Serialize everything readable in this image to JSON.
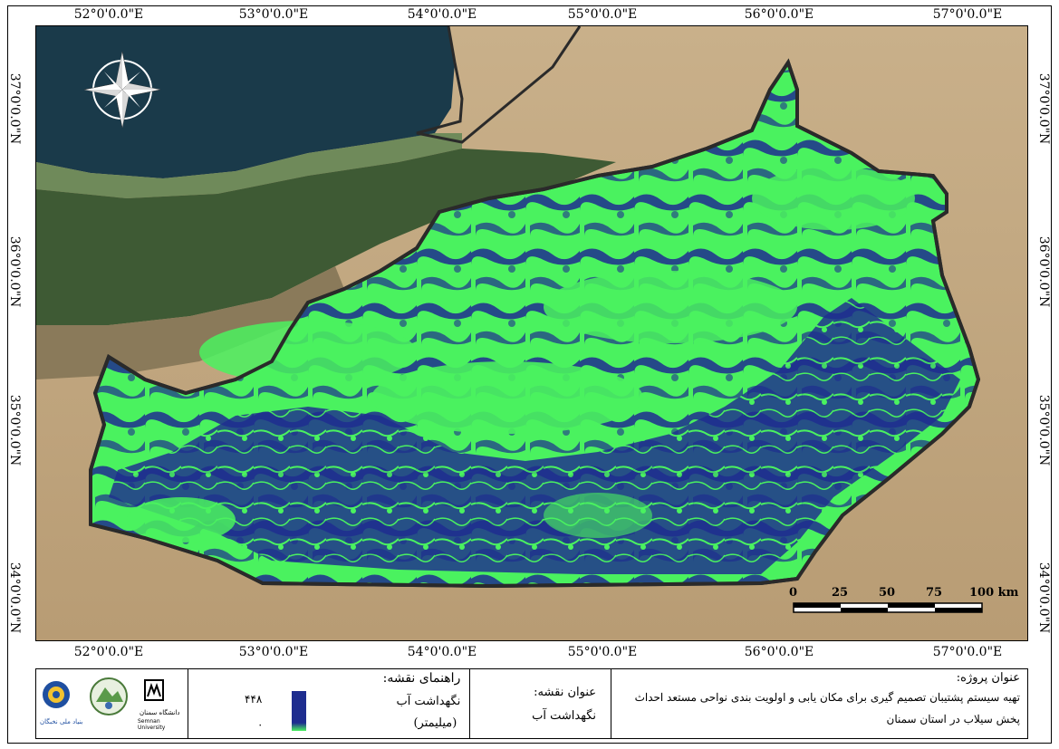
{
  "map": {
    "top_longitudes": [
      "52°0'0.0\"E",
      "53°0'0.0\"E",
      "54°0'0.0\"E",
      "55°0'0.0\"E",
      "56°0'0.0\"E",
      "57°0'0.0\"E"
    ],
    "bottom_longitudes": [
      "52°0'0.0\"E",
      "53°0'0.0\"E",
      "54°0'0.0\"E",
      "55°0'0.0\"E",
      "56°0'0.0\"E",
      "57°0'0.0\"E"
    ],
    "left_latitudes": [
      "37°0'0.0\"N",
      "36°0'0.0\"N",
      "35°0'0.0\"N",
      "34°0'0.0\"N"
    ],
    "right_latitudes": [
      "37°0'0.0\"N",
      "36°0'0.0\"N",
      "35°0'0.0\"N",
      "34°0'0.0\"N"
    ],
    "scale_labels": [
      "0",
      "25",
      "50",
      "75",
      "100 km"
    ],
    "colors": {
      "sea": "#1a3a4a",
      "forest": "#3e5a34",
      "desert": "#b8a07c",
      "high_retention": "#1e2d8f",
      "low_retention": "#4af25f",
      "boundary": "#2a2a2a"
    }
  },
  "legend": {
    "title": "راهنمای نقشه:",
    "item_label": "نگهداشت آب",
    "item_unit": "(میلیمتر)",
    "max_value": "۴۴۸",
    "min_value": "۰"
  },
  "map_title": {
    "label": "عنوان نقشه:",
    "value": "نگهداشت آب"
  },
  "project": {
    "label": "عنوان پروژه:",
    "line1": "تهیه سیستم پشتیبان تصمیم گیری برای مکان یابی و اولویت بندی نواحی مستعد احداث",
    "line2": "پخش سیلاب در استان سمنان"
  },
  "logos": {
    "foundation_name": "بنیاد ملی نخبگان",
    "university_name": "دانشگاه سمنان",
    "university_en": "Semnan University"
  }
}
